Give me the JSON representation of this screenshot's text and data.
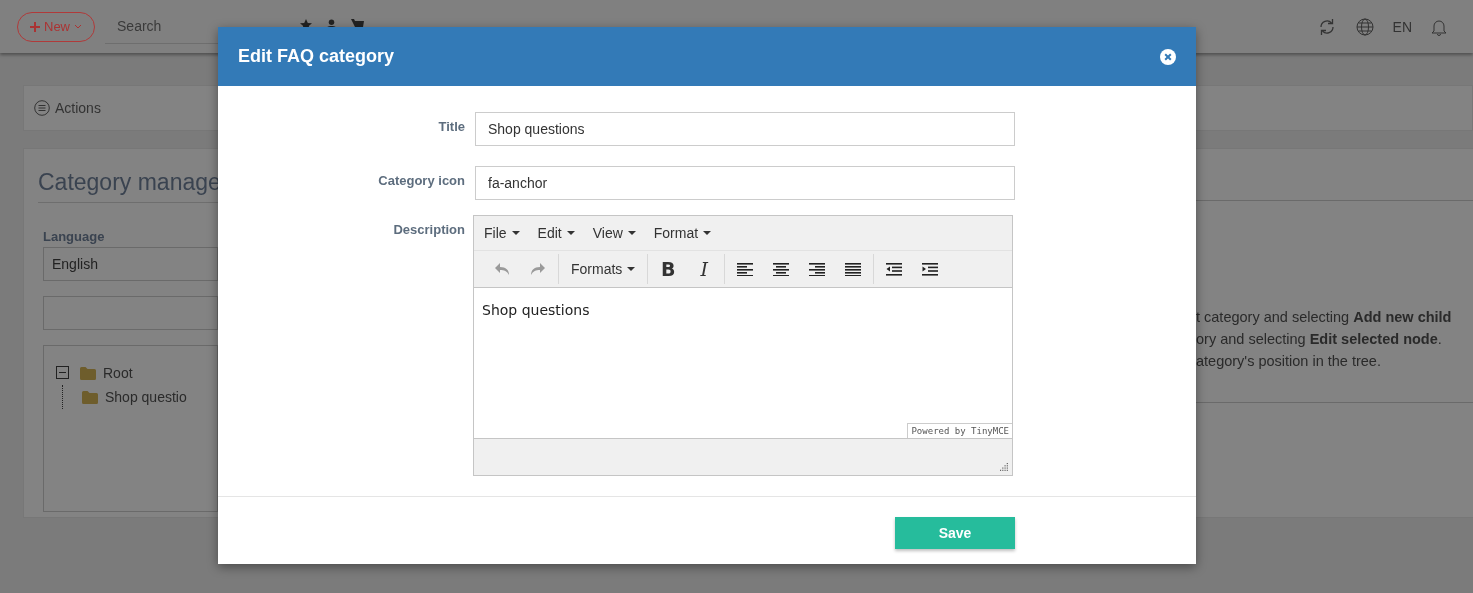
{
  "topbar": {
    "new_button": "New",
    "search": {
      "placeholder": "Search"
    },
    "language": "EN"
  },
  "actions_panel": {
    "label": "Actions"
  },
  "category_panel": {
    "heading": "Category manage",
    "language_label": "Language",
    "language_value": "English",
    "tree": [
      {
        "label": "Root",
        "expanded": true,
        "children": [
          {
            "label": "Shop questio"
          }
        ]
      }
    ],
    "help_lines": [
      "t category and selecting **Add new child**",
      "ory and selecting **Edit selected node**.",
      "ategory's position in the tree."
    ]
  },
  "dialog": {
    "title": "Edit FAQ category",
    "fields": [
      {
        "label": "Title",
        "value": "Shop questions"
      },
      {
        "label": "Category icon",
        "value": "fa-anchor"
      }
    ],
    "description": {
      "label": "Description",
      "menus": [
        "File",
        "Edit",
        "View",
        "Format"
      ],
      "history": [
        {
          "kind": "undo",
          "disabled": true
        },
        {
          "kind": "redo",
          "disabled": true
        }
      ],
      "formats_label": "Formats",
      "styles": [
        {
          "kind": "bold",
          "glyph": "B"
        },
        {
          "kind": "italic",
          "glyph": "I"
        }
      ],
      "content": "Shop questions",
      "branding": "Powered by TinyMCE"
    },
    "save_button": "Save"
  }
}
